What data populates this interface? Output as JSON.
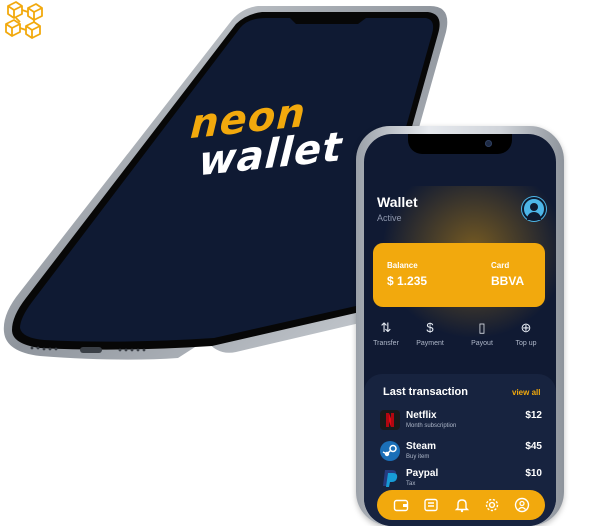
{
  "splash": {
    "brand_top": "neon",
    "brand_bottom": "wallet",
    "logo_icon": "network-cubes-icon"
  },
  "wallet": {
    "title": "Wallet",
    "status": "Active",
    "card": {
      "balance_label": "Balance",
      "balance_value": "$ 1.235",
      "card_label": "Card",
      "card_value": "BBVA"
    },
    "actions": [
      {
        "label": "Transfer",
        "icon": "transfer-arrows-icon",
        "glyph": "⇅"
      },
      {
        "label": "Payment",
        "icon": "payment-hand-icon",
        "glyph": "$"
      },
      {
        "label": "Payout",
        "icon": "payout-phone-icon",
        "glyph": "▯"
      },
      {
        "label": "Top up",
        "icon": "plus-circle-icon",
        "glyph": "⊕"
      }
    ],
    "transactions_title": "Last transaction",
    "view_all": "view all",
    "transactions": [
      {
        "name": "Netflix",
        "desc": "Month subscription",
        "amount": "$12",
        "icon": "netflix-icon",
        "color": "#e50914"
      },
      {
        "name": "Steam",
        "desc": "Buy item",
        "amount": "$45",
        "icon": "steam-icon",
        "color": "#1b6fb8"
      },
      {
        "name": "Paypal",
        "desc": "Tax",
        "amount": "$10",
        "icon": "paypal-icon",
        "color": "#2a5ab3"
      }
    ],
    "tabbar": [
      "wallet-icon",
      "cards-icon",
      "bell-icon",
      "settings-icon",
      "profile-icon"
    ]
  },
  "colors": {
    "accent": "#f2a90d",
    "background_dark": "#101a33",
    "panel": "#17233f"
  }
}
